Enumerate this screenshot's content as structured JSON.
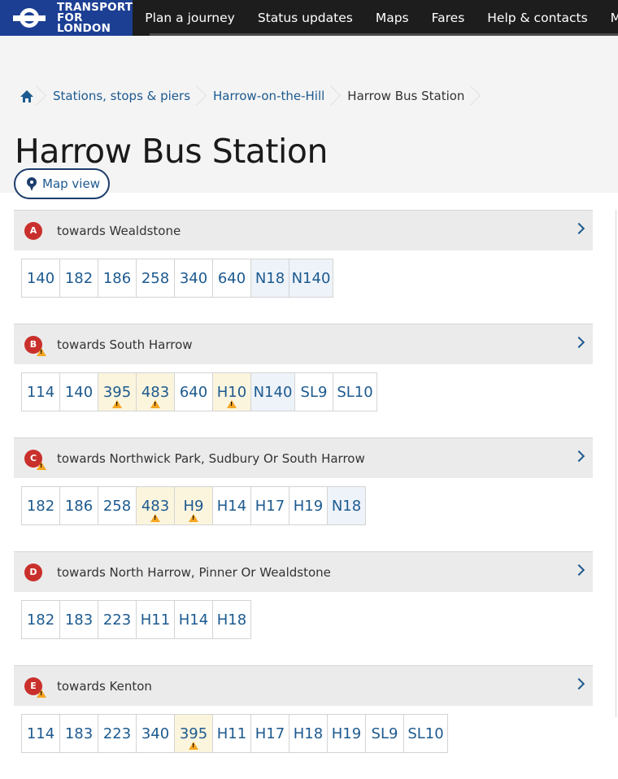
{
  "brand": {
    "line1": "TRANSPORT",
    "line2": "FOR LONDON"
  },
  "nav": {
    "items": [
      "Plan a journey",
      "Status updates",
      "Maps",
      "Fares",
      "Help & contacts",
      "Mo"
    ]
  },
  "breadcrumb": {
    "items": [
      "Stations, stops & piers",
      "Harrow-on-the-Hill",
      "Harrow Bus Station"
    ]
  },
  "page_title": "Harrow Bus Station",
  "map_view_label": "Map view",
  "stops": [
    {
      "letter": "A",
      "towards": "towards Wealdstone",
      "warning": false,
      "routes": [
        {
          "n": "140"
        },
        {
          "n": "182"
        },
        {
          "n": "186"
        },
        {
          "n": "258"
        },
        {
          "n": "340"
        },
        {
          "n": "640"
        },
        {
          "n": "N18",
          "night": true
        },
        {
          "n": "N140",
          "night": true
        }
      ]
    },
    {
      "letter": "B",
      "towards": "towards South Harrow",
      "warning": true,
      "routes": [
        {
          "n": "114"
        },
        {
          "n": "140"
        },
        {
          "n": "395",
          "warn": true
        },
        {
          "n": "483",
          "warn": true
        },
        {
          "n": "640"
        },
        {
          "n": "H10",
          "warn": true
        },
        {
          "n": "N140",
          "night": true
        },
        {
          "n": "SL9"
        },
        {
          "n": "SL10"
        }
      ]
    },
    {
      "letter": "C",
      "towards": "towards Northwick Park, Sudbury Or South Harrow",
      "warning": true,
      "routes": [
        {
          "n": "182"
        },
        {
          "n": "186"
        },
        {
          "n": "258"
        },
        {
          "n": "483",
          "warn": true
        },
        {
          "n": "H9",
          "warn": true
        },
        {
          "n": "H14"
        },
        {
          "n": "H17"
        },
        {
          "n": "H19"
        },
        {
          "n": "N18",
          "night": true
        }
      ]
    },
    {
      "letter": "D",
      "towards": "towards North Harrow, Pinner Or Wealdstone",
      "warning": false,
      "routes": [
        {
          "n": "182"
        },
        {
          "n": "183"
        },
        {
          "n": "223"
        },
        {
          "n": "H11"
        },
        {
          "n": "H14"
        },
        {
          "n": "H18"
        }
      ]
    },
    {
      "letter": "E",
      "towards": "towards Kenton",
      "warning": true,
      "routes": [
        {
          "n": "114"
        },
        {
          "n": "183"
        },
        {
          "n": "223"
        },
        {
          "n": "340"
        },
        {
          "n": "395",
          "warn": true
        },
        {
          "n": "H11"
        },
        {
          "n": "H17"
        },
        {
          "n": "H18"
        },
        {
          "n": "H19"
        },
        {
          "n": "SL9"
        },
        {
          "n": "SL10"
        }
      ]
    }
  ],
  "colors": {
    "brand": "#1c3f94",
    "link": "#1d5a8f",
    "stop_badge": "#c9302c",
    "warning": "#f5a623",
    "warn_bg": "#fbf5de",
    "night_bg": "#eef3fa"
  }
}
